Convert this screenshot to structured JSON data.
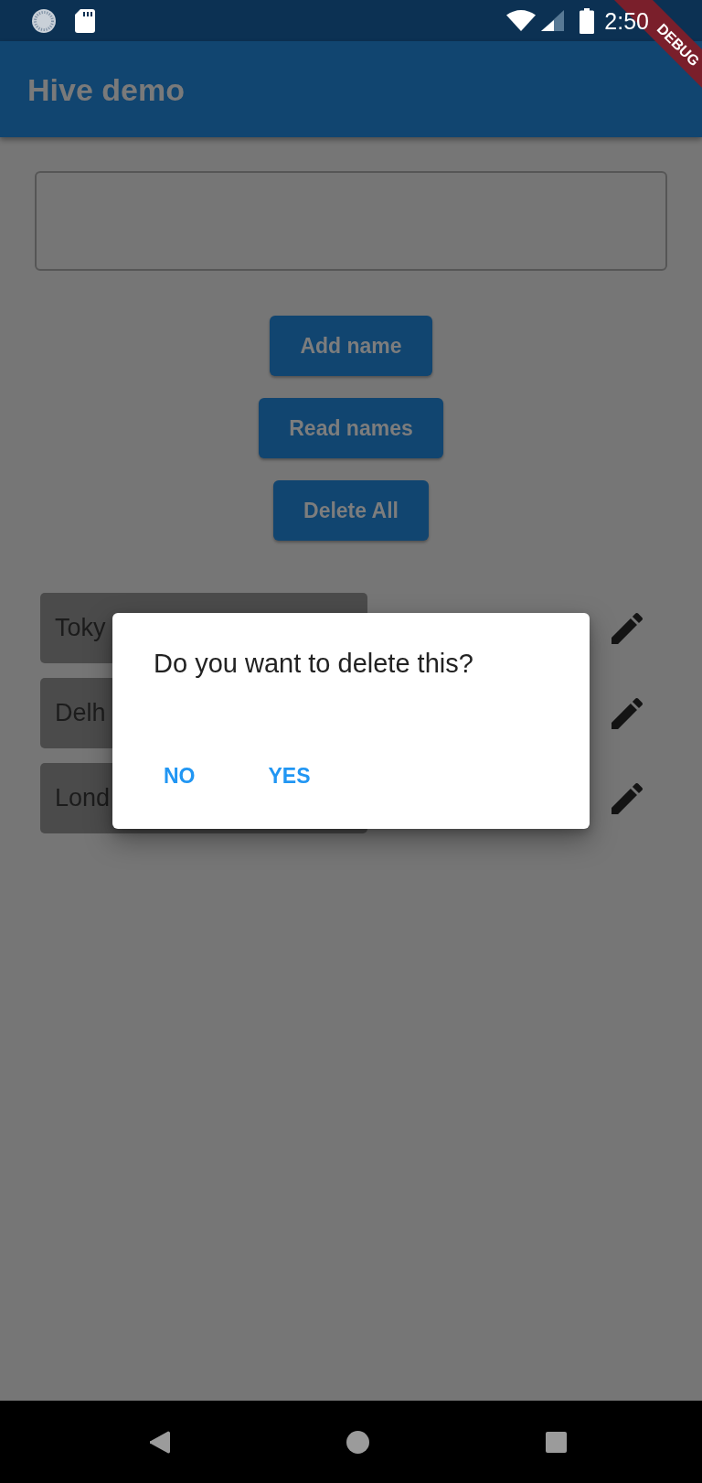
{
  "status_bar": {
    "time": "2:50"
  },
  "debug_banner": "DEBUG",
  "app_bar": {
    "title": "Hive demo"
  },
  "buttons": [
    "Add name",
    "Read names",
    "Delete All"
  ],
  "names": [
    "Toky",
    "Delh",
    "Lond"
  ],
  "dialog": {
    "message": "Do you want to delete this?",
    "actions": [
      "NO",
      "YES"
    ]
  }
}
